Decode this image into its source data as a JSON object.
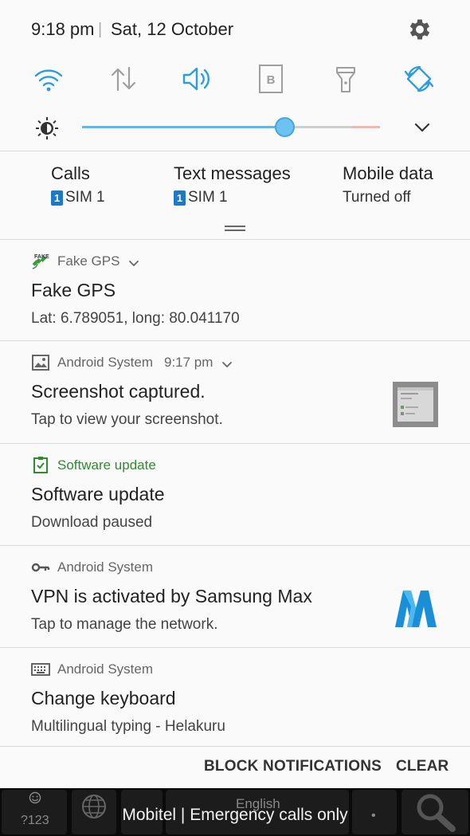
{
  "status": {
    "time": "9:18 pm",
    "separator": "|",
    "date": "Sat, 12 October"
  },
  "colors": {
    "accent": "#2d9de0",
    "inactive_icon": "#9e9e9e",
    "update_green": "#2e8b2e",
    "slider": "#5fb8e8"
  },
  "quick_settings": [
    {
      "icon": "wifi-icon",
      "active": true
    },
    {
      "icon": "mobile-data-icon",
      "active": false
    },
    {
      "icon": "sound-icon",
      "active": true
    },
    {
      "icon": "blocking-mode-icon",
      "active": false,
      "glyph": "B"
    },
    {
      "icon": "flashlight-icon",
      "active": false
    },
    {
      "icon": "auto-rotate-icon",
      "active": true
    }
  ],
  "brightness": {
    "level": 0.68
  },
  "sim_cards": [
    {
      "title": "Calls",
      "badge": "1",
      "value": "SIM 1"
    },
    {
      "title": "Text messages",
      "badge": "1",
      "value": "SIM 1"
    },
    {
      "title": "Mobile data",
      "badge": "",
      "value": "Turned off"
    }
  ],
  "notifications": [
    {
      "app": "Fake GPS",
      "time": "",
      "title": "Fake GPS",
      "text": "Lat: 6.789051, long: 80.041170",
      "icon": "fake-gps-icon"
    },
    {
      "app": "Android System",
      "time": "9:17 pm",
      "title": "Screenshot captured.",
      "text": "Tap to view your screenshot.",
      "icon": "image-icon"
    },
    {
      "app": "Software update",
      "time": "",
      "title": "Software update",
      "text": "Download paused",
      "icon": "software-update-icon"
    },
    {
      "app": "Android System",
      "time": "",
      "title": "VPN is activated by Samsung Max",
      "text": "Tap to manage the network.",
      "icon": "key-icon"
    },
    {
      "app": "Android System",
      "time": "",
      "title": "Change keyboard",
      "text": "Multilingual typing - Helakuru",
      "icon": "keyboard-icon"
    }
  ],
  "actions": {
    "block": "BLOCK NOTIFICATIONS",
    "clear": "CLEAR"
  },
  "keyboard": {
    "sym_key": "?123",
    "language": "English",
    "dot": "•"
  },
  "carrier": "Mobitel | Emergency calls only"
}
